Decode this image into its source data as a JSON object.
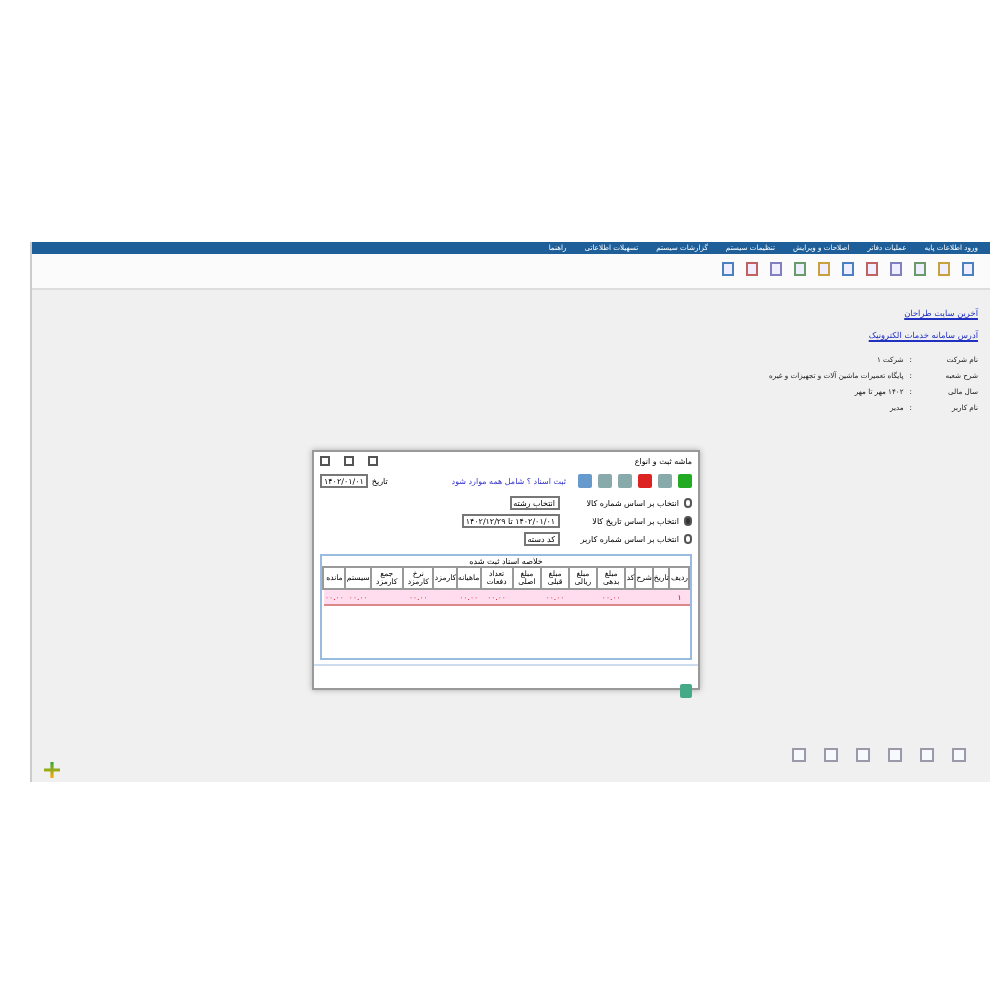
{
  "menu": [
    "ورود اطلاعات پایه",
    "عملیات دفاتر",
    "اصلاحات و ویرایش",
    "تنظیمات سیستم",
    "گزارشات سیستم",
    "تسهیلات اطلاعاتی",
    "راهنما"
  ],
  "links": [
    "آخرین سایت طراحان",
    "آدرس سامانه خدمات الکترونیک"
  ],
  "info": [
    {
      "label": "نام شرکت",
      "separator": ":",
      "value": "شرکت ۱"
    },
    {
      "label": "شرح شعبه",
      "separator": ":",
      "value": "پایگاه تعمیرات ماشین آلات و تجهیزات و غیره"
    },
    {
      "label": "سال مالی",
      "separator": ":",
      "value": "۱۴۰۲ مهر تا مهر"
    },
    {
      "label": "نام کاربر",
      "separator": ":",
      "value": "مدیر"
    }
  ],
  "dialog": {
    "title": "ماشه ثبت و انواع",
    "date_label": "تاریخ",
    "date_value": "۱۴۰۲/۰۱/۰۱",
    "filter_label": "ثبت اسناد ؟ شامل همه موارد شود",
    "options": [
      {
        "label": "انتخاب بر اساس شماره کالا",
        "selected": false,
        "field": "انتخاب رشته"
      },
      {
        "label": "انتخاب بر اساس تاریخ کالا",
        "selected": true,
        "field": "۱۴۰۲/۰۱/۰۱ تا ۱۴۰۲/۱۲/۲۹"
      },
      {
        "label": "انتخاب بر اساس شماره کاربر",
        "selected": false,
        "field": "کد دسته"
      }
    ],
    "table_title": "خلاصه اسناد ثبت شده",
    "columns": [
      "ردیف",
      "تاریخ",
      "شرح",
      "کد",
      "مبلغ بدهی",
      "مبلغ ریالی",
      "مبلغ قبلی",
      "مبلغ اصلی",
      "تعداد دفعات",
      "ماهیانه",
      "کارمزد",
      "نرخ کارمزد",
      "جمع کارمزد",
      "سیستم",
      "مانده"
    ],
    "rows": [
      [
        "۱",
        "",
        "",
        "",
        "۰۰.۰۰",
        "",
        "۰۰.۰۰",
        "",
        "۰۰.۰۰",
        "۰۰.۰۰",
        "",
        "۰۰.۰۰",
        "",
        "۰۰.۰۰",
        "۰۰.۰۰"
      ]
    ]
  }
}
